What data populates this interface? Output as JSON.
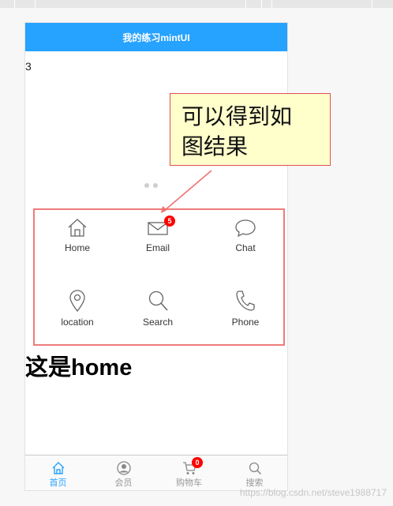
{
  "header": {
    "title": "我的练习mintUI"
  },
  "counter": "3",
  "grid": {
    "items": [
      {
        "label": "Home",
        "icon": "home-icon"
      },
      {
        "label": "Email",
        "icon": "email-icon",
        "badge": "5"
      },
      {
        "label": "Chat",
        "icon": "chat-icon"
      },
      {
        "label": "location",
        "icon": "location-icon"
      },
      {
        "label": "Search",
        "icon": "search-icon"
      },
      {
        "label": "Phone",
        "icon": "phone-icon"
      }
    ]
  },
  "home_title": "这是home",
  "tabbar": {
    "tabs": [
      {
        "label": "首页",
        "icon": "home-icon",
        "active": true
      },
      {
        "label": "会员",
        "icon": "user-icon"
      },
      {
        "label": "购物车",
        "icon": "cart-icon",
        "badge": "0"
      },
      {
        "label": "搜索",
        "icon": "search-icon"
      }
    ]
  },
  "callout": {
    "line1": "可以得到如",
    "line2": "图结果"
  },
  "watermark": "https://blog.csdn.net/steve1988717",
  "colors": {
    "header_bg": "#26a2ff",
    "badge": "#ff0000",
    "callout_bg": "#ffffcc",
    "callout_border": "#e05050"
  }
}
